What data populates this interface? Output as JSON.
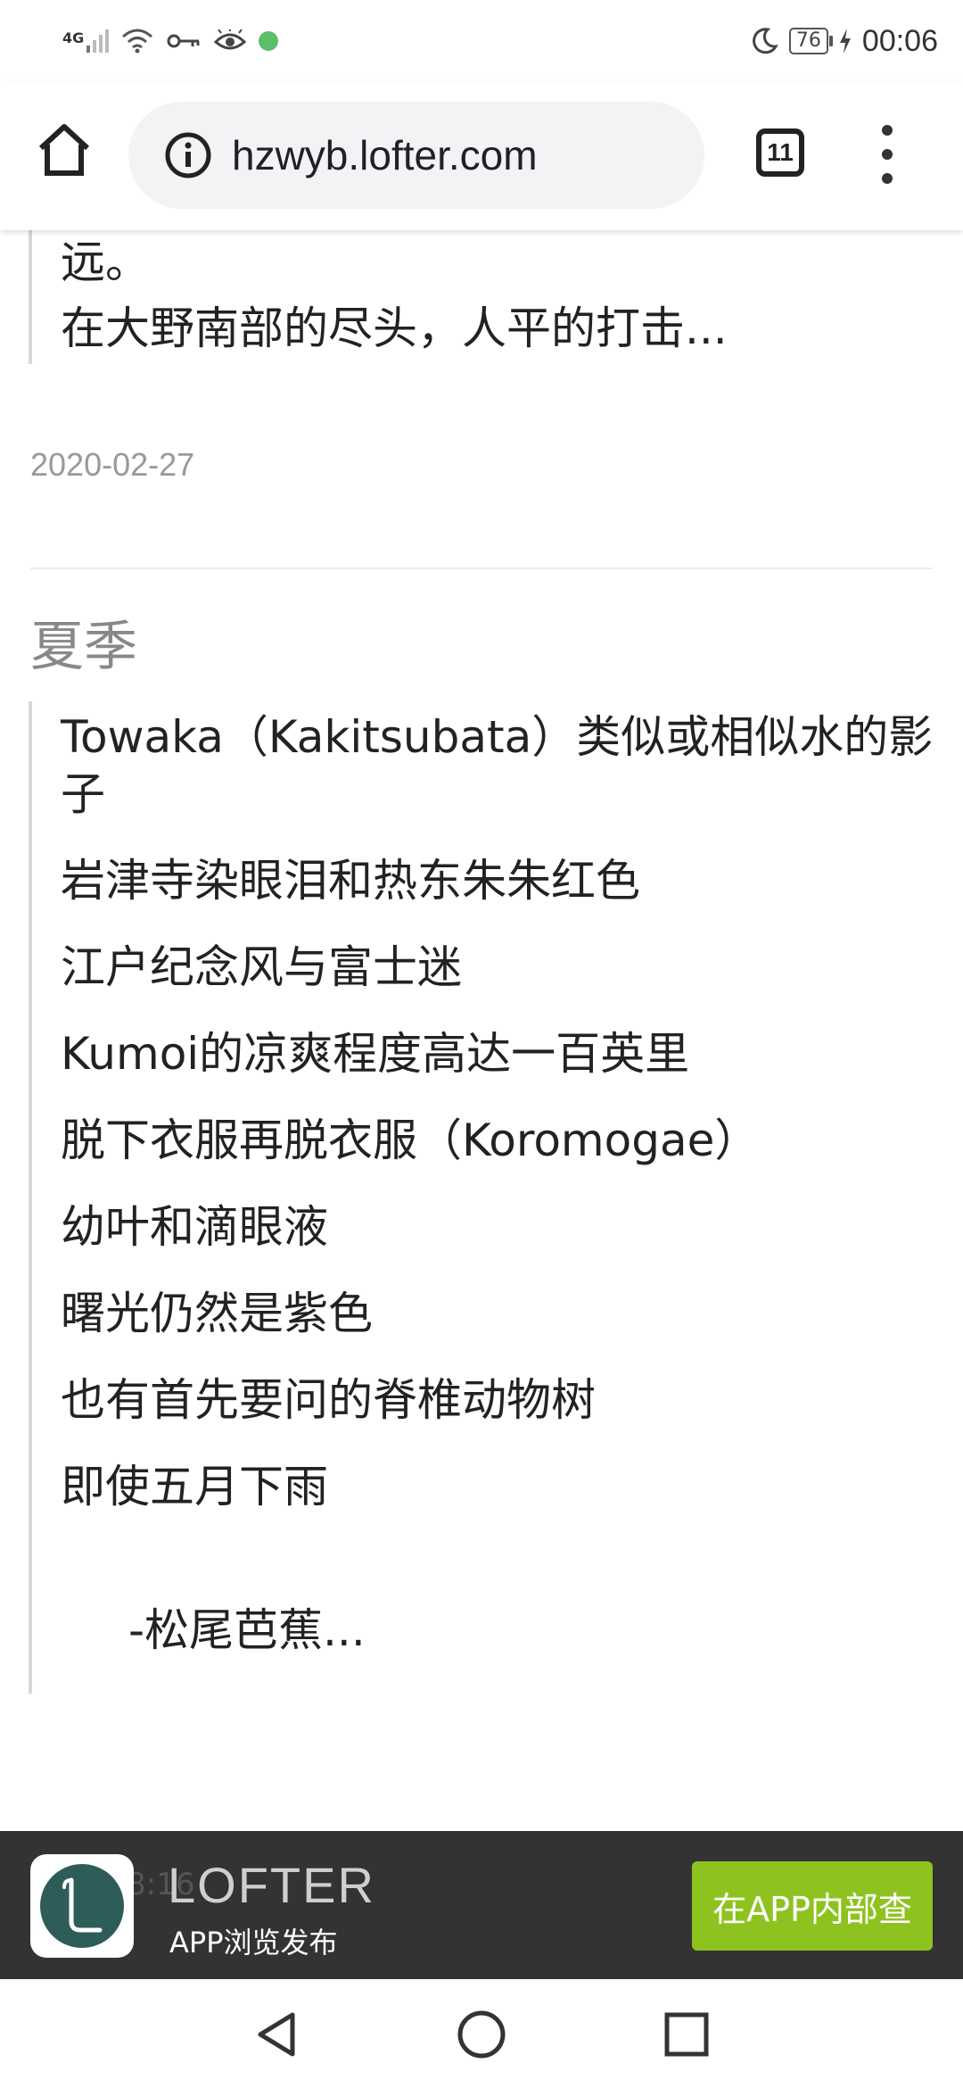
{
  "status_bar": {
    "signal": "4G",
    "battery": "76",
    "time": "00:06"
  },
  "browser": {
    "url": "hzwyb.lofter.com",
    "tab_count": "11"
  },
  "prev_post": {
    "excerpt_line1": "远。",
    "excerpt_line2": "在大野南部的尽头，人平的打击...",
    "date": "2020-02-27"
  },
  "post": {
    "title": "夏季",
    "lines": [
      "Towaka（Kakitsubata）类似或相似水的影子",
      "岩津寺染眼泪和热东朱朱红色",
      "江户纪念风与富士迷",
      "Kumoi的凉爽程度高达一百英里",
      "脱下衣服再脱衣服（Koromogae）",
      "幼叶和滴眼液",
      "曙光仍然是紫色",
      "也有首先要问的脊椎动物树",
      "即使五月下雨"
    ],
    "signature": "-松尾芭蕉..."
  },
  "banner": {
    "faint_text": "8:16",
    "brand": "LOFTER",
    "subtitle": "APP浏览发布",
    "open_button": "在APP内部查"
  },
  "colors": {
    "banner_bg": "#333333",
    "button_green": "#8ec31f",
    "app_icon": "#2e5d59"
  }
}
